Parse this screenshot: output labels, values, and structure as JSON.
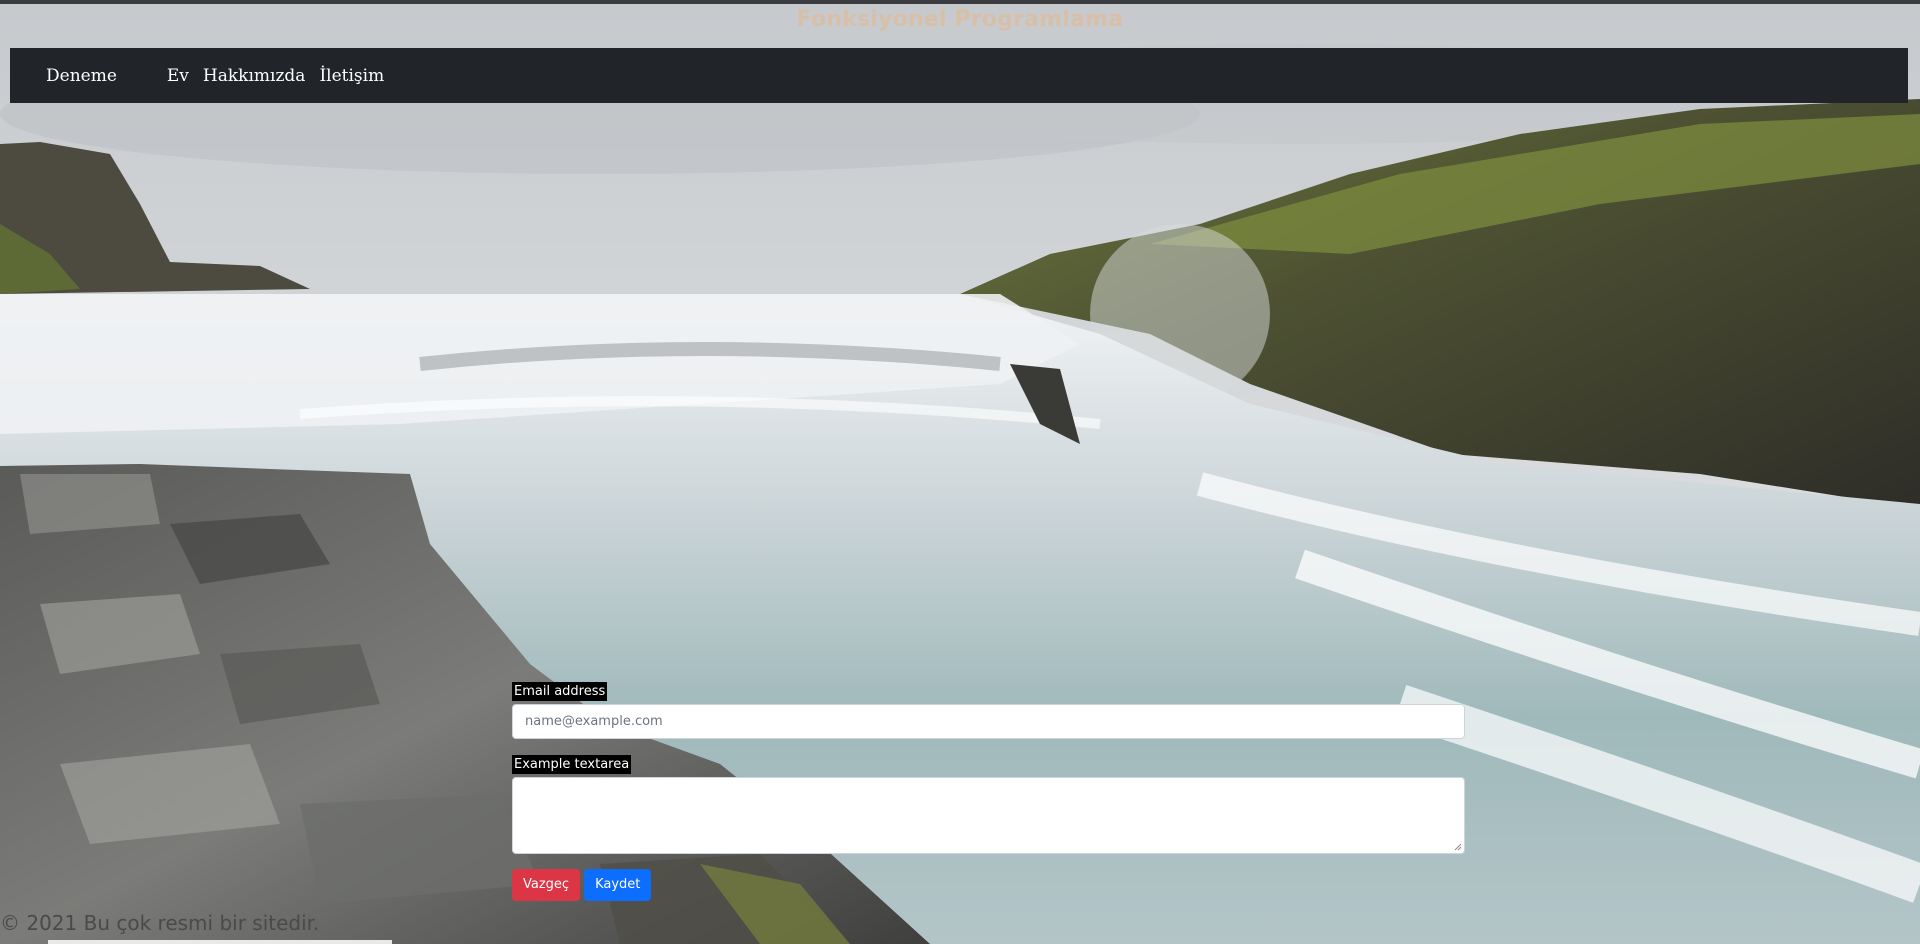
{
  "header": {
    "title": "Fonksiyonel Programlama"
  },
  "navbar": {
    "brand": "Deneme",
    "links": [
      "Ev",
      "Hakkımızda",
      "İletişim"
    ]
  },
  "form": {
    "email_label": "Email address",
    "email_placeholder": "name@example.com",
    "email_value": "",
    "textarea_label": "Example textarea",
    "textarea_value": "",
    "cancel_label": "Vazgeç",
    "save_label": "Kaydet"
  },
  "footer": {
    "text": "© 2021 Bu çok resmi bir sitedir."
  },
  "colors": {
    "navbar_bg": "#212529",
    "title": "#d8bfa7",
    "danger": "#dc3545",
    "primary": "#0d6efd"
  },
  "background": {
    "scene": "waterfall-landscape"
  }
}
